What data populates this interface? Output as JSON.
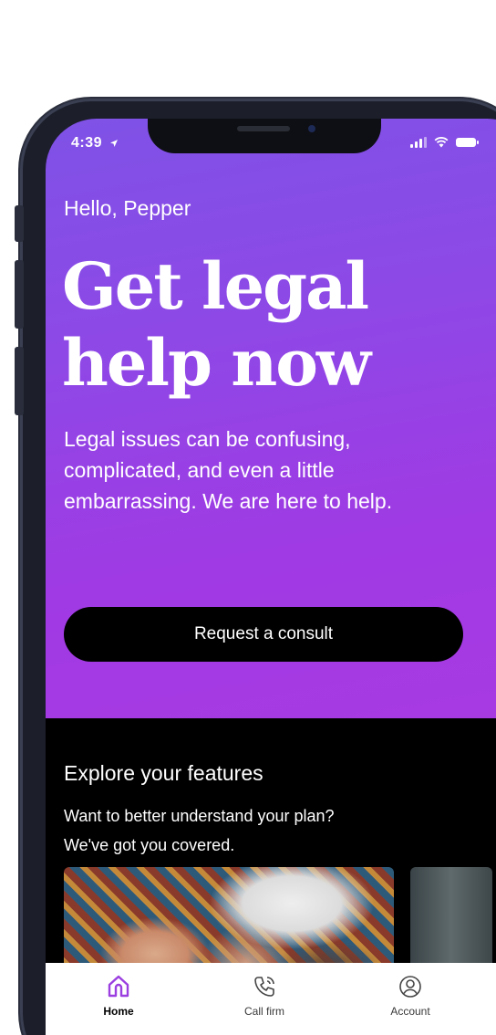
{
  "status_bar": {
    "time": "4:39",
    "icons": [
      "location-arrow-icon",
      "cellular-signal-icon",
      "wifi-icon",
      "battery-icon"
    ]
  },
  "hero": {
    "greeting": "Hello, Pepper",
    "headline_line1": "Get legal",
    "headline_line2": "help now",
    "description": "Legal issues can be confusing, complicated, and even a little embarrassing. We are here to help.",
    "cta_label": "Request a consult"
  },
  "features": {
    "title": "Explore your features",
    "subtitle_line1": "Want to better understand your plan?",
    "subtitle_line2": "We've got you covered."
  },
  "tabbar": {
    "items": [
      {
        "label": "Home",
        "icon": "home-icon",
        "active": true
      },
      {
        "label": "Call firm",
        "icon": "phone-call-icon",
        "active": false
      },
      {
        "label": "Account",
        "icon": "account-icon",
        "active": false
      }
    ]
  },
  "colors": {
    "hero_gradient_start": "#7f52e6",
    "hero_gradient_end": "#a83ae2",
    "accent_active_tab": "#9b3fe0",
    "button_bg": "#000000",
    "dark_section_bg": "#000000"
  }
}
